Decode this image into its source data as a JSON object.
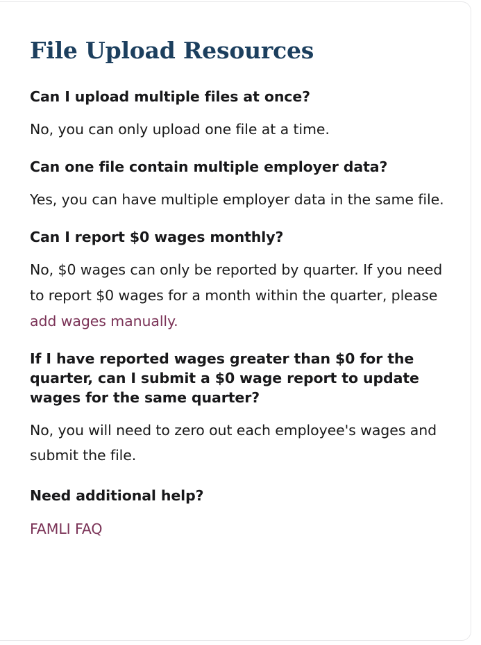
{
  "page": {
    "title": "File Upload Resources",
    "background": "#ffffff",
    "title_color": "#1c3f5e",
    "text_color": "#1a1a1a",
    "link_color": "#7b3357",
    "card_border_color": "#e8e8ea"
  },
  "faq": [
    {
      "question": "Can I upload multiple files at once?",
      "answer": "No, you can only upload one file at a time."
    },
    {
      "question": "Can one file contain multiple employer data?",
      "answer": "Yes, you can have multiple employer data in the same file."
    },
    {
      "question": "Can I report $0 wages monthly?",
      "answer_before_link": "No, $0 wages can only be reported by quarter. If you need to report $0 wages for a month within the quarter, please ",
      "answer_link": "add wages manually.",
      "answer_after_link": ""
    },
    {
      "question": "If I have reported wages greater than $0 for the quarter, can I submit a $0 wage report to update wages for the same quarter?",
      "answer": "No, you will need to zero out each employee's wages and submit the file."
    }
  ],
  "help": {
    "heading": "Need additional help?",
    "link_label": "FAMLI FAQ"
  }
}
